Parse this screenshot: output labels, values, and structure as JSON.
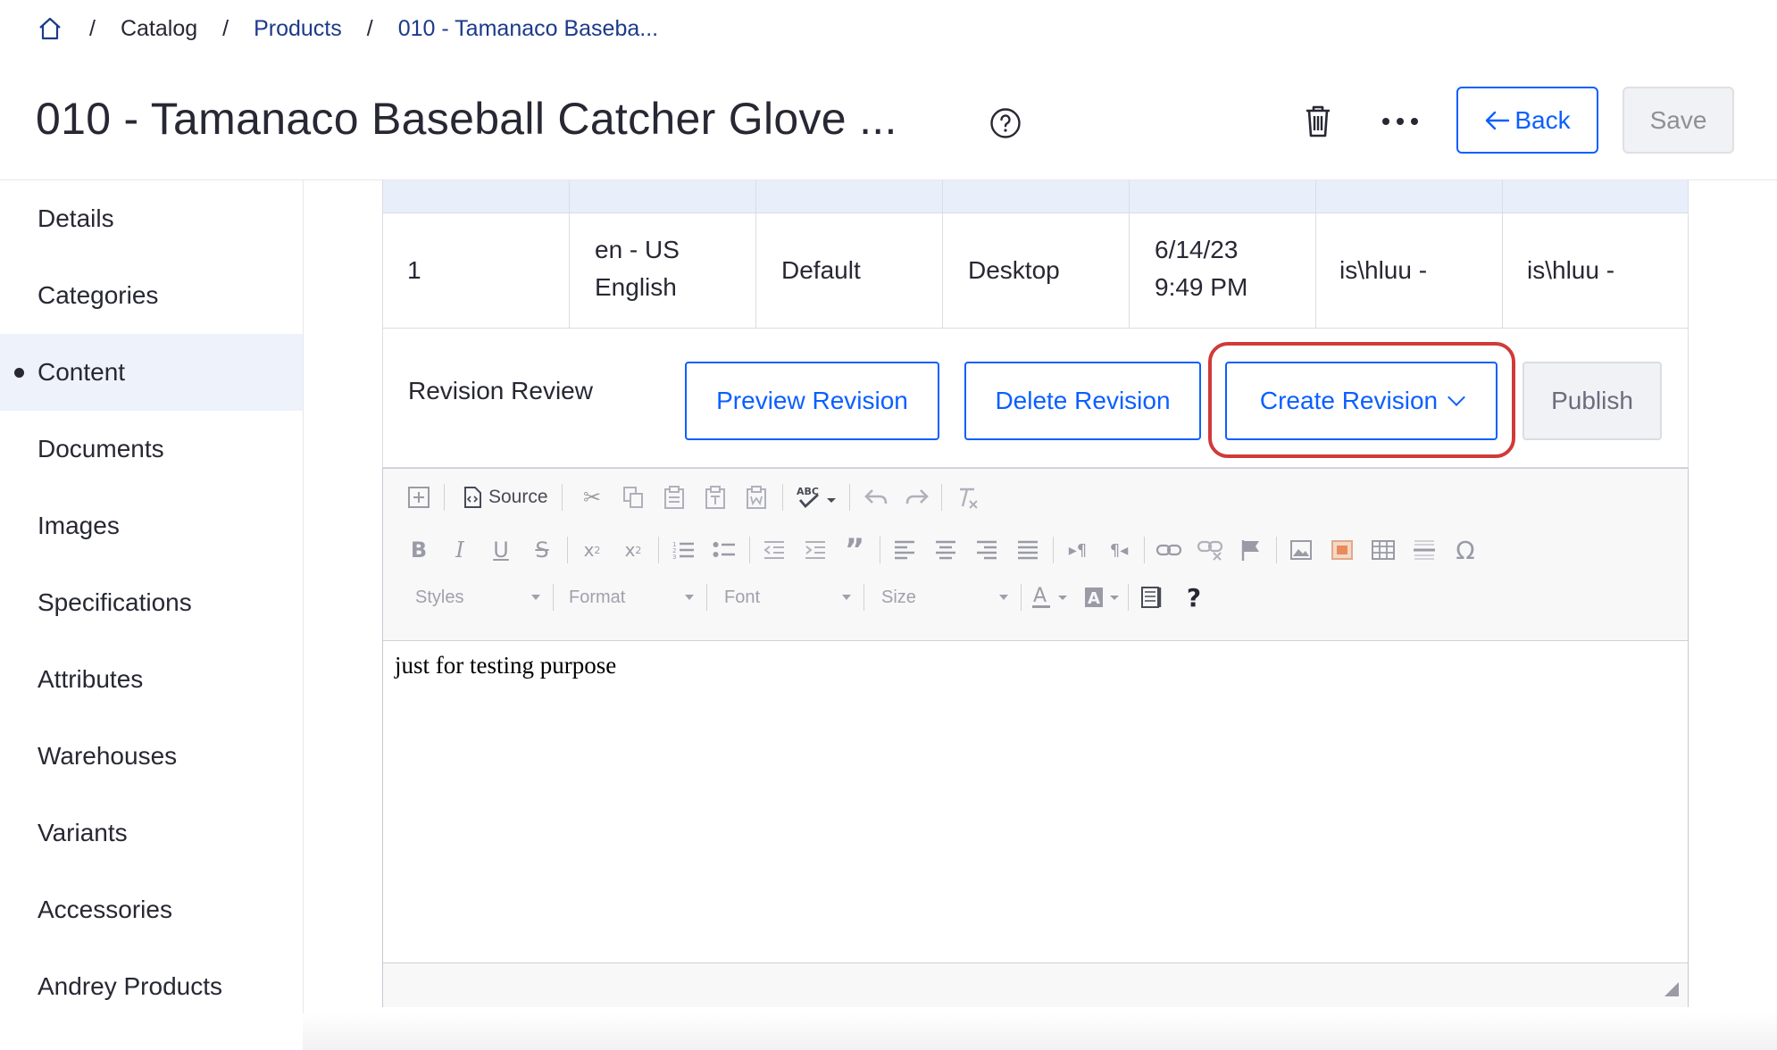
{
  "breadcrumb": {
    "items": [
      "Catalog",
      "Products",
      "010 - Tamanaco Baseba..."
    ]
  },
  "header": {
    "title": "010 - Tamanaco Baseball Catcher Glove ...",
    "back_label": "Back",
    "save_label": "Save"
  },
  "sidebar": {
    "items": [
      {
        "label": "Details"
      },
      {
        "label": "Categories"
      },
      {
        "label": "Content"
      },
      {
        "label": "Documents"
      },
      {
        "label": "Images"
      },
      {
        "label": "Specifications"
      },
      {
        "label": "Attributes"
      },
      {
        "label": "Warehouses"
      },
      {
        "label": "Variants"
      },
      {
        "label": "Accessories"
      },
      {
        "label": "Andrey Products"
      }
    ],
    "active": "Content"
  },
  "table": {
    "row": {
      "revision": "1",
      "language_line1": "en - US",
      "language_line2": "English",
      "persona": "Default",
      "device": "Desktop",
      "date_line1": "6/14/23",
      "date_line2": "9:49 PM",
      "created_by": "is\\hluu -",
      "modified_by": "is\\hluu -"
    }
  },
  "revision": {
    "label": "Revision Review",
    "preview_label": "Preview Revision",
    "delete_label": "Delete Revision",
    "create_label": "Create Revision",
    "publish_label": "Publish"
  },
  "editor": {
    "source_label": "Source",
    "styles_label": "Styles",
    "format_label": "Format",
    "font_label": "Font",
    "size_label": "Size",
    "content": "just for testing purpose"
  },
  "colors": {
    "primary": "#0b5fff",
    "highlight": "#d13a3a",
    "active_nav": "#eef2fa",
    "table_header": "#e9eefb"
  }
}
